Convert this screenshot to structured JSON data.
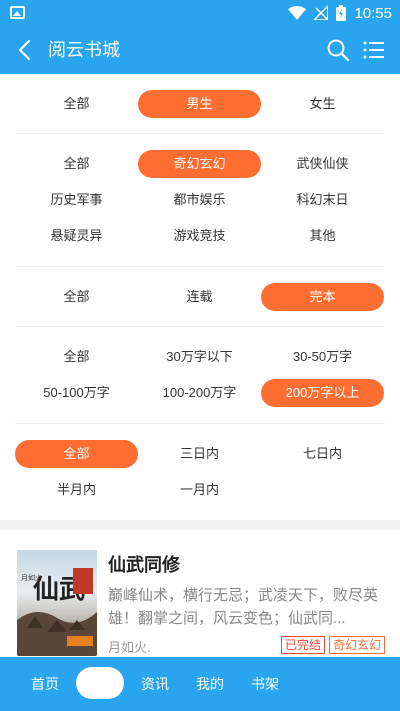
{
  "status_bar": {
    "time": "10:55"
  },
  "app_bar": {
    "title": "阅云书城"
  },
  "filters": {
    "gender": [
      {
        "label": "全部",
        "active": false
      },
      {
        "label": "男生",
        "active": true
      },
      {
        "label": "女生",
        "active": false
      }
    ],
    "category": [
      {
        "label": "全部",
        "active": false
      },
      {
        "label": "奇幻玄幻",
        "active": true
      },
      {
        "label": "武侠仙侠",
        "active": false
      },
      {
        "label": "历史军事",
        "active": false
      },
      {
        "label": "都市娱乐",
        "active": false
      },
      {
        "label": "科幻末日",
        "active": false
      },
      {
        "label": "悬疑灵异",
        "active": false
      },
      {
        "label": "游戏竞技",
        "active": false
      },
      {
        "label": "其他",
        "active": false
      }
    ],
    "status": [
      {
        "label": "全部",
        "active": false
      },
      {
        "label": "连载",
        "active": false
      },
      {
        "label": "完本",
        "active": true
      }
    ],
    "word_count": [
      {
        "label": "全部",
        "active": false
      },
      {
        "label": "30万字以下",
        "active": false
      },
      {
        "label": "30-50万字",
        "active": false
      },
      {
        "label": "50-100万字",
        "active": false
      },
      {
        "label": "100-200万字",
        "active": false
      },
      {
        "label": "200万字以上",
        "active": true
      }
    ],
    "update_time": [
      {
        "label": "全部",
        "active": true
      },
      {
        "label": "三日内",
        "active": false
      },
      {
        "label": "七日内",
        "active": false
      },
      {
        "label": "半月内",
        "active": false
      },
      {
        "label": "一月内",
        "active": false
      }
    ]
  },
  "book": {
    "title": "仙武同修",
    "description": "巅峰仙术，横行无忌；武凌天下，败尽英雄！翻掌之间，风云变色；仙武同...",
    "author": "月如火.",
    "tags": [
      "已完结",
      "奇幻玄幻"
    ],
    "cover_text": "仙武",
    "cover_author": "月如火"
  },
  "bottom_nav": {
    "items": [
      "首页",
      "资讯",
      "我的",
      "书架"
    ]
  },
  "colors": {
    "primary": "#29a5f0",
    "accent": "#fe6e33"
  }
}
